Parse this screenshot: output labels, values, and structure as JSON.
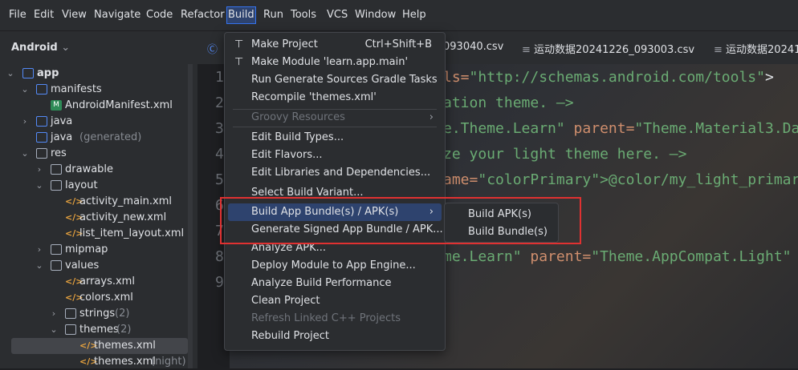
{
  "menubar": [
    "File",
    "Edit",
    "View",
    "Navigate",
    "Code",
    "Refactor",
    "Build",
    "Run",
    "Tools",
    "VCS",
    "Window",
    "Help"
  ],
  "project_view": {
    "title": "Android",
    "tree": [
      {
        "label": "app",
        "bold": true
      },
      {
        "label": "manifests"
      },
      {
        "label": "AndroidManifest.xml"
      },
      {
        "label": "java"
      },
      {
        "label": "java",
        "suffix": "(generated)"
      },
      {
        "label": "res"
      },
      {
        "label": "drawable"
      },
      {
        "label": "layout"
      },
      {
        "label": "activity_main.xml"
      },
      {
        "label": "activity_new.xml"
      },
      {
        "label": "list_item_layout.xml"
      },
      {
        "label": "mipmap"
      },
      {
        "label": "values"
      },
      {
        "label": "arrays.xml"
      },
      {
        "label": "colors.xml"
      },
      {
        "label": "strings",
        "suffix": "(2)"
      },
      {
        "label": "themes",
        "suffix": "(2)"
      },
      {
        "label": "themes.xml"
      },
      {
        "label": "themes.xml",
        "suffix": "(night)"
      }
    ]
  },
  "tabs": [
    "093040.csv",
    "运动数据20241226_093003.csv",
    "运动数据2024122"
  ],
  "editor": {
    "line_numbers": [
      "1",
      "2",
      "3",
      "4",
      "5",
      "6",
      "7",
      "8",
      "9"
    ],
    "lines": [
      {
        "a": "ls=",
        "b": "\"http://schemas.android.com/tools\"",
        "c": ">"
      },
      {
        "a": "ation theme. —>",
        "b": "",
        "c": ""
      },
      {
        "a": "e.Theme.Learn\"",
        "b": " parent=",
        "c": "\"Theme.Material3.Da"
      },
      {
        "a": "ze your light theme here. —>",
        "b": "",
        "c": ""
      },
      {
        "a": "ame=",
        "b": "\"colorPrimary\">@color/my_light_primar",
        "c": ""
      },
      {
        "a": "",
        "b": "",
        "c": ""
      },
      {
        "a": "",
        "b": "",
        "c": ""
      },
      {
        "a": "me.Learn\"",
        "b": " parent=",
        "c": "\"Theme.AppCompat.Light\""
      },
      {
        "a": "",
        "b": "",
        "c": ""
      }
    ]
  },
  "build_menu": {
    "items": [
      {
        "label": "Make Project",
        "shortcut": "Ctrl+Shift+B",
        "icon": "hammer-icon"
      },
      {
        "label": "Make Module 'learn.app.main'",
        "icon": "module-hammer-icon"
      },
      {
        "label": "Run Generate Sources Gradle Tasks"
      },
      {
        "label": "Recompile 'themes.xml'"
      },
      {
        "label": "Groovy Resources",
        "disabled": true,
        "submenu": true
      },
      {
        "label": "Edit Build Types..."
      },
      {
        "label": "Edit Flavors..."
      },
      {
        "label": "Edit Libraries and Dependencies..."
      },
      {
        "label": "Select Build Variant..."
      },
      {
        "label": "Build App Bundle(s) / APK(s)",
        "highlighted": true,
        "submenu": true
      },
      {
        "label": "Generate Signed App Bundle / APK..."
      },
      {
        "label": "Analyze APK..."
      },
      {
        "label": "Deploy Module to App Engine..."
      },
      {
        "label": "Analyze Build Performance"
      },
      {
        "label": "Clean Project"
      },
      {
        "label": "Refresh Linked C++ Projects",
        "disabled": true
      },
      {
        "label": "Rebuild Project"
      }
    ]
  },
  "build_submenu": [
    "Build APK(s)",
    "Build Bundle(s)"
  ],
  "colors": {
    "accent": "#2e436e",
    "highlight_box": "#e03131",
    "string": "#6aab73",
    "keyword": "#cf8e6d"
  }
}
